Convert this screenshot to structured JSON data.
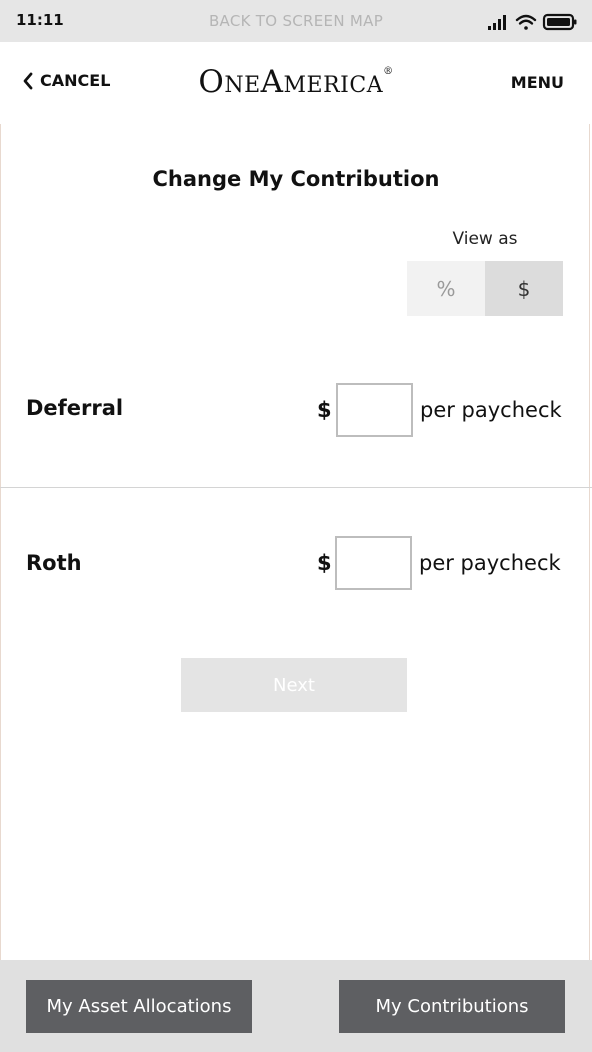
{
  "status_bar": {
    "time": "11:11",
    "center_link": "BACK TO SCREEN MAP",
    "icons": [
      "signal-icon",
      "wifi-icon",
      "battery-icon"
    ]
  },
  "nav": {
    "cancel_label": "CANCEL",
    "logo_text": "OneAmerica",
    "logo_mark": "®",
    "menu_label": "MENU"
  },
  "page": {
    "title": "Change My Contribution",
    "view_as_label": "View as",
    "toggle": {
      "percent_label": "%",
      "dollar_label": "$",
      "selected": "$"
    }
  },
  "contributions": [
    {
      "label": "Deferral",
      "currency": "$",
      "value": "",
      "suffix": "per paycheck"
    },
    {
      "label": "Roth",
      "currency": "$",
      "value": "",
      "suffix": "per paycheck"
    }
  ],
  "next_label": "Next",
  "bottom_tabs": {
    "asset_allocations": "My Asset Allocations",
    "contributions": "My Contributions"
  },
  "colors": {
    "status_bg": "#e6e6e6",
    "tab_button": "#5e5f62",
    "next_disabled": "#e4e4e4",
    "toggle_selected": "#dcdcdc"
  }
}
